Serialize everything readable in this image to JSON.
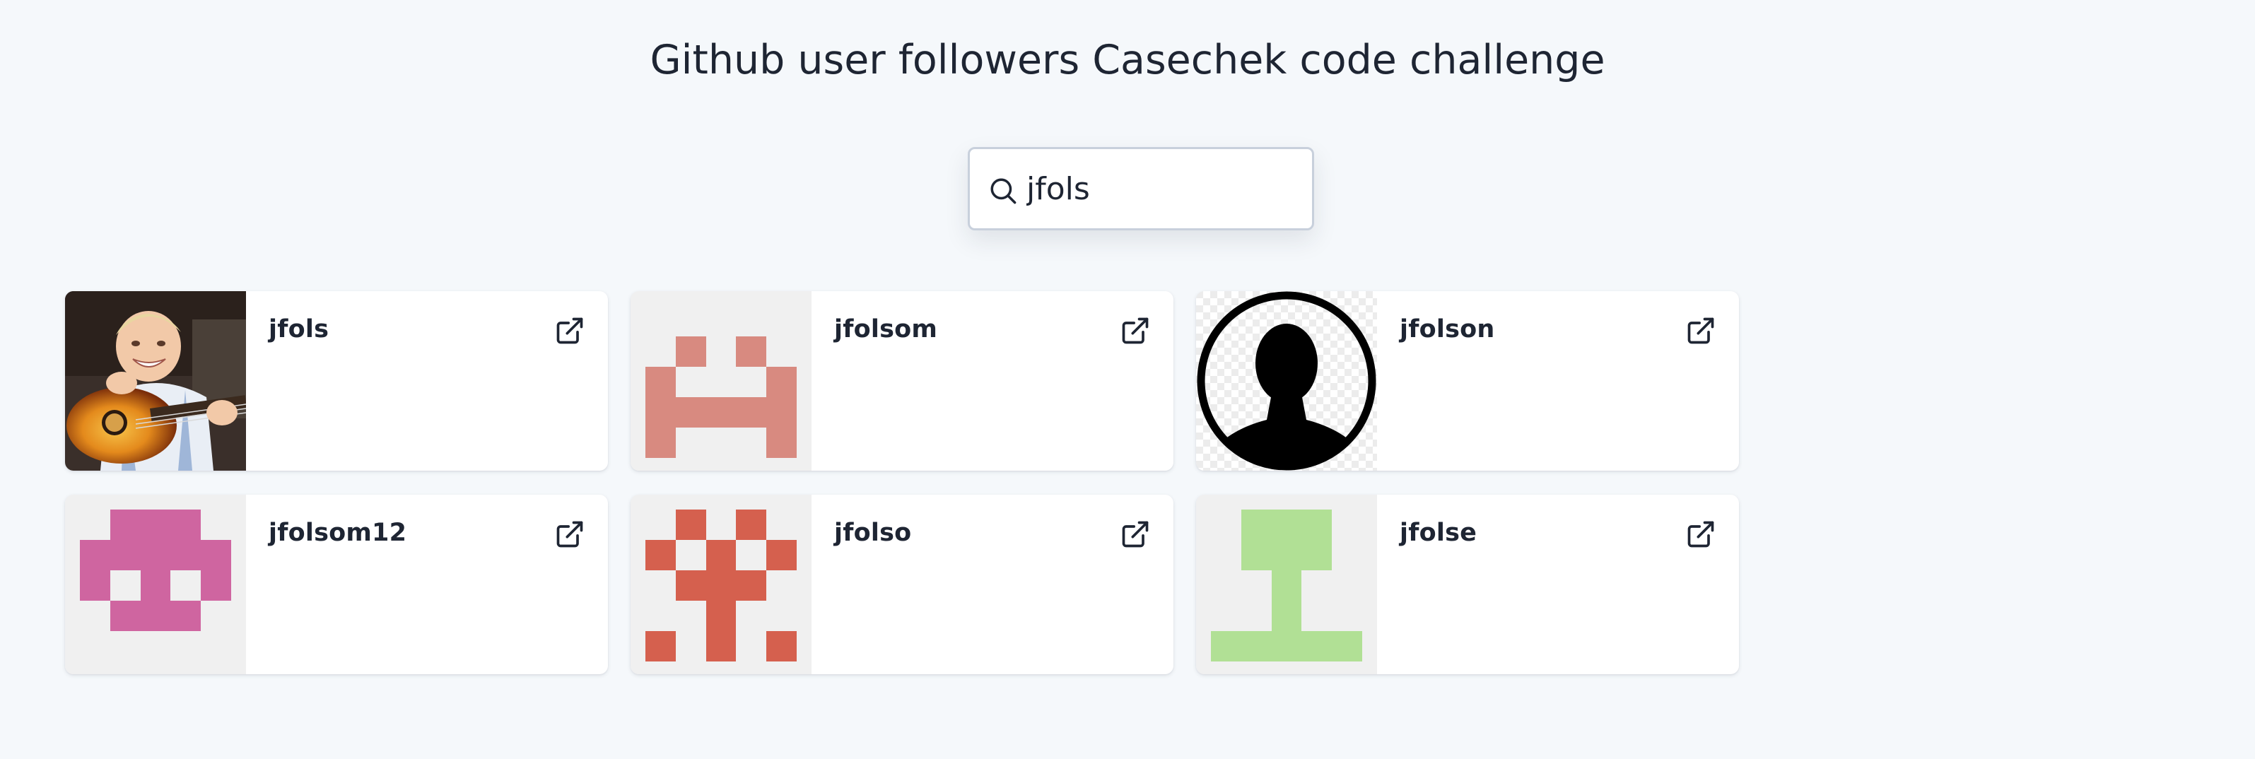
{
  "header": {
    "title": "Github user followers Casechek code challenge"
  },
  "search": {
    "value": "jfols",
    "icon": "search-icon"
  },
  "users": [
    {
      "login": "jfols",
      "avatar": "photo-child-guitar",
      "link_icon": "external-link-icon"
    },
    {
      "login": "jfolsom",
      "avatar": "identicon",
      "avatar_color": "#d88a80",
      "link_icon": "external-link-icon"
    },
    {
      "login": "jfolson",
      "avatar": "silhouette-placeholder",
      "link_icon": "external-link-icon"
    },
    {
      "login": "jfolsom12",
      "avatar": "identicon",
      "avatar_color": "#cf65a0",
      "link_icon": "external-link-icon"
    },
    {
      "login": "jfolso",
      "avatar": "identicon",
      "avatar_color": "#d5604e",
      "link_icon": "external-link-icon"
    },
    {
      "login": "jfolse",
      "avatar": "identicon",
      "avatar_color": "#b1e095",
      "link_icon": "external-link-icon"
    }
  ],
  "colors": {
    "background": "#f5f8fb",
    "card": "#ffffff",
    "text": "#1e2533",
    "input_border": "#c8d0dc"
  }
}
